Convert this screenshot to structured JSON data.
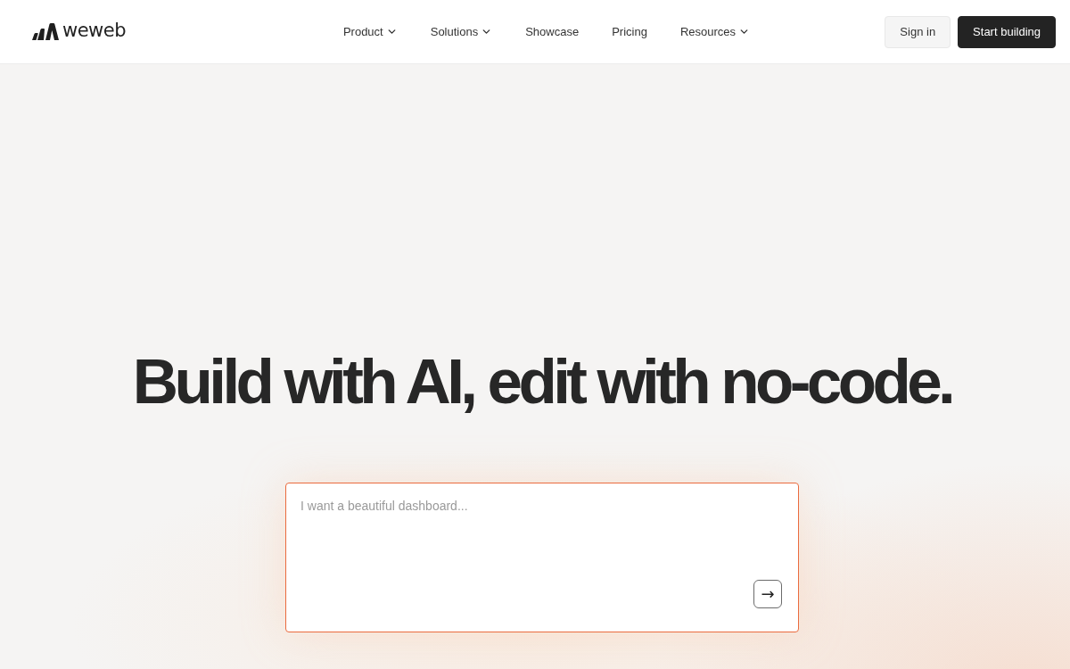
{
  "header": {
    "logo": {
      "text": "weweb"
    },
    "nav": [
      {
        "label": "Product",
        "dropdown": true
      },
      {
        "label": "Solutions",
        "dropdown": true
      },
      {
        "label": "Showcase",
        "dropdown": false
      },
      {
        "label": "Pricing",
        "dropdown": false
      },
      {
        "label": "Resources",
        "dropdown": true
      }
    ],
    "actions": [
      {
        "label": "Sign in",
        "kind": "secondary"
      },
      {
        "label": "Start building",
        "kind": "primary"
      }
    ]
  },
  "hero": {
    "heading": "Build with AI, edit with no-code.",
    "prompt": {
      "placeholder": "I want a beautiful dashboard...",
      "submit": "→"
    }
  }
}
